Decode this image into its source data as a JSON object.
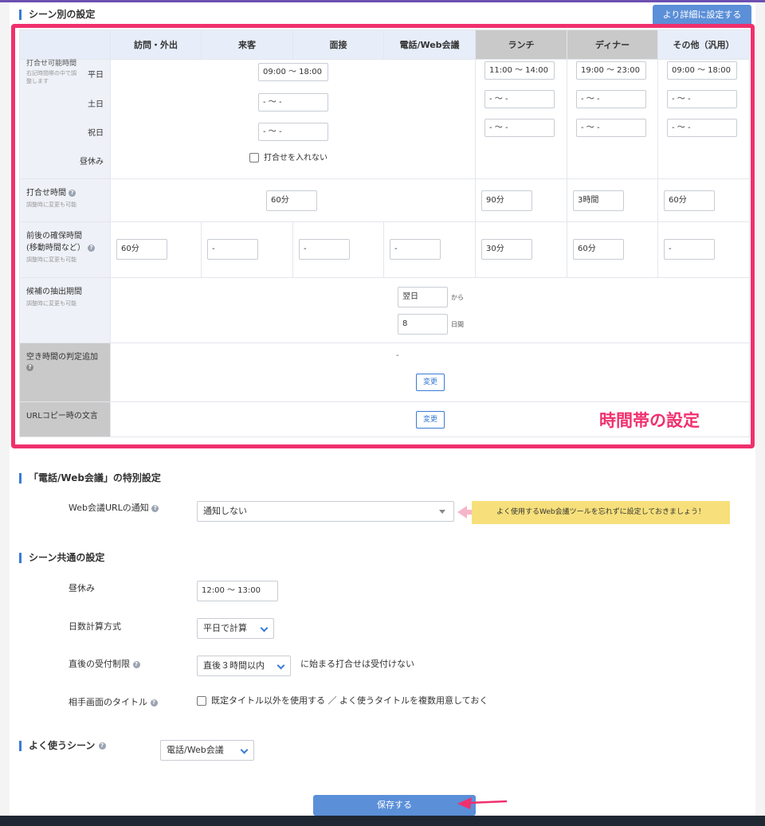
{
  "header": {
    "title": "シーン別の設定",
    "detail_button": "より詳細に設定する"
  },
  "table": {
    "columns": [
      "訪問・外出",
      "来客",
      "面接",
      "電話/Web会議",
      "ランチ",
      "ディナー",
      "その他（汎用）"
    ],
    "rows": {
      "meeting_hours": {
        "label": "打合せ可能時間",
        "sub": "右記時間帯の中で調整します",
        "weekday": "平日",
        "saturday": "土日",
        "holiday": "祝日",
        "lunch_break": "昼休み",
        "shared_weekday": "09:00 〜 18:00",
        "shared_saturday": "- 〜 -",
        "shared_holiday": "- 〜 -",
        "no_meeting_checkbox": "打合せを入れない",
        "lunch_weekday": "11:00 〜 14:00",
        "lunch_saturday": "- 〜 -",
        "lunch_holiday": "- 〜 -",
        "dinner_weekday": "19:00 〜 23:00",
        "dinner_saturday": "- 〜 -",
        "dinner_holiday": "- 〜 -",
        "other_weekday": "09:00 〜 18:00",
        "other_saturday": "- 〜 -",
        "other_holiday": "- 〜 -"
      },
      "duration": {
        "label": "打合せ時間",
        "sub": "調整時に変更も可能",
        "shared": "60分",
        "lunch": "90分",
        "dinner": "3時間",
        "other": "60分"
      },
      "buffer": {
        "label": "前後の確保時間",
        "label2": "(移動時間など）",
        "sub": "調整時に変更も可能",
        "values": [
          "60分",
          "-",
          "-",
          "-",
          "30分",
          "60分",
          "-"
        ]
      },
      "period": {
        "label": "候補の抽出期間",
        "sub": "調整時に変更も可能",
        "start": "翌日",
        "from_label": "から",
        "days": "8",
        "days_label": "日間"
      },
      "free_check": {
        "label": "空き時間の判定追加",
        "value": "-",
        "change": "変更"
      },
      "url_copy": {
        "label": "URLコピー時の文言",
        "change": "変更"
      }
    }
  },
  "highlight_label": "時間帯の設定",
  "web_section": {
    "title": "「電話/Web会議」の特別設定",
    "url_notify_label": "Web会議URLの通知",
    "url_notify_value": "通知しない",
    "tip": "よく使用するWeb会議ツールを忘れずに設定しておきましょう！"
  },
  "common_section": {
    "title": "シーン共通の設定",
    "lunch_label": "昼休み",
    "lunch_value": "12:00 〜 13:00",
    "days_calc_label": "日数計算方式",
    "days_calc_value": "平日で計算",
    "limit_label": "直後の受付制限",
    "limit_value": "直後３時間以内",
    "limit_suffix": "に始まる打合せは受付けない",
    "title_label": "相手画面のタイトル",
    "title_option": "既定タイトル以外を使用する ／ よく使うタイトルを複数用意しておく"
  },
  "favorite": {
    "title": "よく使うシーン",
    "value": "電話/Web会議"
  },
  "save_button": "保存する"
}
